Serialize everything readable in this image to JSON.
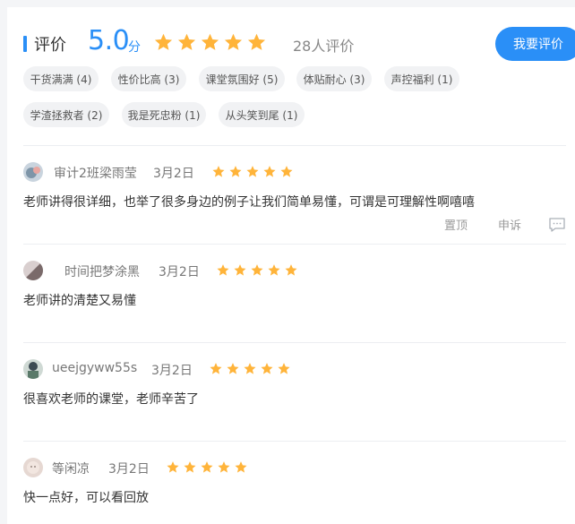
{
  "header": {
    "title": "评价",
    "score": "5.0",
    "score_unit": "分",
    "star_count": 5,
    "count_text": "28人评价",
    "button_label": "我要评价"
  },
  "colors": {
    "accent": "#2a8ff7",
    "star": "#ffb43a"
  },
  "tags": [
    {
      "label": "干货满满 (4)"
    },
    {
      "label": "性价比高 (3)"
    },
    {
      "label": "课堂氛围好 (5)"
    },
    {
      "label": "体贴耐心 (3)"
    },
    {
      "label": "声控福利 (1)"
    },
    {
      "label": "学渣拯救者 (2)"
    },
    {
      "label": "我是死忠粉 (1)"
    },
    {
      "label": "从头笑到尾 (1)"
    }
  ],
  "reviews": [
    {
      "name": "审计2班梁雨莹",
      "date": "3月2日",
      "rating": 5,
      "text": "老师讲得很详细，也举了很多身边的例子让我们简单易懂，可谓是可理解性啊嘻嘻",
      "actions": [
        "置顶",
        "申诉"
      ]
    },
    {
      "name": "时间把梦涂黑",
      "date": "3月2日",
      "rating": 5,
      "text": "老师讲的清楚又易懂"
    },
    {
      "name": "ueejgyww55s",
      "date": "3月2日",
      "rating": 5,
      "text": "很喜欢老师的课堂，老师辛苦了"
    },
    {
      "name": "等闲凉",
      "date": "3月2日",
      "rating": 5,
      "text": "快一点好，可以看回放"
    }
  ]
}
